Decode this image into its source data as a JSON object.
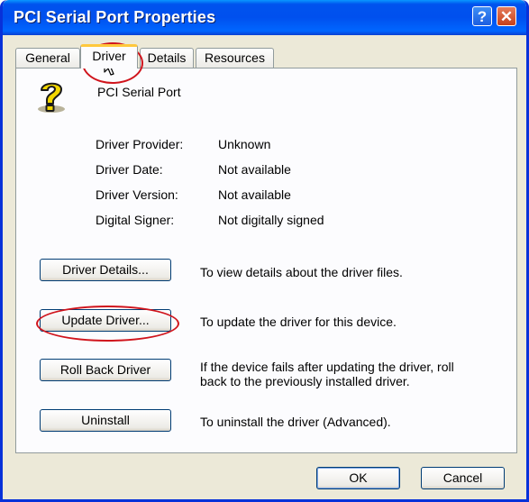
{
  "window": {
    "title": "PCI Serial Port Properties"
  },
  "titlebar_buttons": {
    "help": "?",
    "close": "✕"
  },
  "tabs": [
    {
      "label": "General",
      "active": false
    },
    {
      "label": "Driver",
      "active": true
    },
    {
      "label": "Details",
      "active": false
    },
    {
      "label": "Resources",
      "active": false
    }
  ],
  "device": {
    "name": "PCI Serial Port",
    "icon": "unknown-device-question-icon"
  },
  "driver_info": [
    {
      "label": "Driver Provider:",
      "value": "Unknown"
    },
    {
      "label": "Driver Date:",
      "value": "Not available"
    },
    {
      "label": "Driver Version:",
      "value": "Not available"
    },
    {
      "label": "Digital Signer:",
      "value": "Not digitally signed"
    }
  ],
  "actions": [
    {
      "button": "Driver Details...",
      "description": "To view details about the driver files."
    },
    {
      "button": "Update Driver...",
      "description": "To update the driver for this device."
    },
    {
      "button": "Roll Back Driver",
      "description_line1": "If the device fails after updating the driver, roll",
      "description_line2": "back to the previously installed driver."
    },
    {
      "button": "Uninstall",
      "description": "To uninstall the driver (Advanced)."
    }
  ],
  "footer": {
    "ok": "OK",
    "cancel": "Cancel"
  },
  "colors": {
    "titlebar": "#0053ee",
    "highlight_ellipse": "#d0141c",
    "tab_accent": "#ffc83c"
  }
}
